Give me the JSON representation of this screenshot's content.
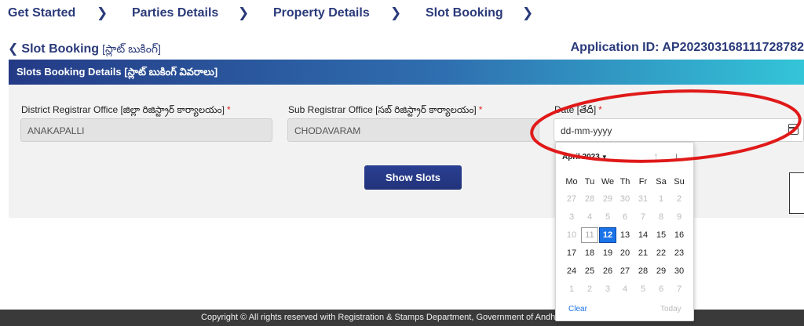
{
  "stepper": {
    "steps": [
      "Get Started",
      "Parties Details",
      "Property Details",
      "Slot Booking"
    ]
  },
  "title": {
    "back_label": "Slot Booking",
    "back_label_te": "[స్లాట్ బుకింగ్]",
    "application_id": "Application ID: AP202303168111728782"
  },
  "section": {
    "title": "Slots Booking Details [స్లాట్ బుకింగ్ వివరాలు]"
  },
  "form": {
    "district_label": "District Registrar Office [జిల్లా రిజిస్ట్రార్ కార్యాలయం]",
    "district_value": "ANAKAPALLI",
    "sub_label": "Sub Registrar Office [సబ్ రిజిస్ట్రార్ కార్యాలయం]",
    "sub_value": "CHODAVARAM",
    "date_label": "Date [తేదీ]",
    "date_placeholder": "dd-mm-yyyy",
    "required_mark": "*",
    "show_slots_label": "Show Slots"
  },
  "calendar": {
    "month_label": "April 2023",
    "weekdays": [
      "Mo",
      "Tu",
      "We",
      "Th",
      "Fr",
      "Sa",
      "Su"
    ],
    "weeks": [
      [
        "27",
        "28",
        "29",
        "30",
        "31",
        "1",
        "2"
      ],
      [
        "3",
        "4",
        "5",
        "6",
        "7",
        "8",
        "9"
      ],
      [
        "10",
        "11",
        "12",
        "13",
        "14",
        "15",
        "16"
      ],
      [
        "17",
        "18",
        "19",
        "20",
        "21",
        "22",
        "23"
      ],
      [
        "24",
        "25",
        "26",
        "27",
        "28",
        "29",
        "30"
      ],
      [
        "1",
        "2",
        "3",
        "4",
        "5",
        "6",
        "7"
      ]
    ],
    "selected_day": "12",
    "clear_label": "Clear",
    "today_label": "Today"
  },
  "footer": {
    "text": "Copyright © All rights reserved with Registration & Stamps Department, Government of Andhra Pradesh"
  },
  "colors": {
    "brand": "#2a3a7a",
    "accent": "#1a73e8",
    "annotation": "#e01919"
  }
}
